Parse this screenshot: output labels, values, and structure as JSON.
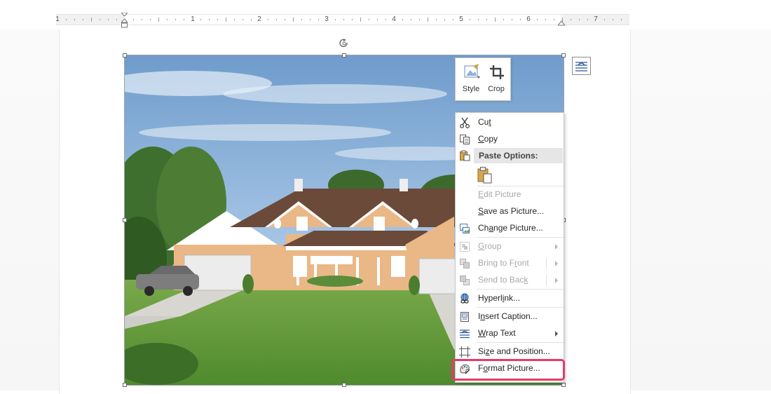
{
  "ruler": {
    "numbers": [
      "1",
      "1",
      "2",
      "3",
      "4",
      "5",
      "6",
      "7"
    ]
  },
  "mini_toolbar": {
    "style_label": "Style",
    "crop_label": "Crop"
  },
  "context_menu": {
    "items": {
      "cut": {
        "pre": "Cu",
        "key": "t",
        "post": ""
      },
      "copy": {
        "pre": "",
        "key": "C",
        "post": "opy"
      },
      "paste_options": "Paste Options:",
      "edit_picture": {
        "pre": "",
        "key": "E",
        "post": "dit Picture"
      },
      "save_as_picture": {
        "pre": "",
        "key": "S",
        "post": "ave as Picture..."
      },
      "change_picture": {
        "pre": "Ch",
        "key": "a",
        "post": "nge Picture..."
      },
      "group": {
        "pre": "",
        "key": "G",
        "post": "roup"
      },
      "bring_to_front": {
        "pre": "Bring to F",
        "key": "r",
        "post": "ont"
      },
      "send_to_back": {
        "pre": "Send to Bac",
        "key": "k",
        "post": ""
      },
      "hyperlink": {
        "pre": "Hyperl",
        "key": "i",
        "post": "nk..."
      },
      "insert_caption": {
        "pre": "I",
        "key": "n",
        "post": "sert Caption..."
      },
      "wrap_text": {
        "pre": "",
        "key": "W",
        "post": "rap Text"
      },
      "size_and_position": {
        "pre": "Si",
        "key": "z",
        "post": "e and Position..."
      },
      "format_picture": {
        "pre": "F",
        "key": "o",
        "post": "rmat Picture..."
      }
    }
  },
  "colors": {
    "highlight": "#e8396b",
    "accent": "#2b579a"
  }
}
